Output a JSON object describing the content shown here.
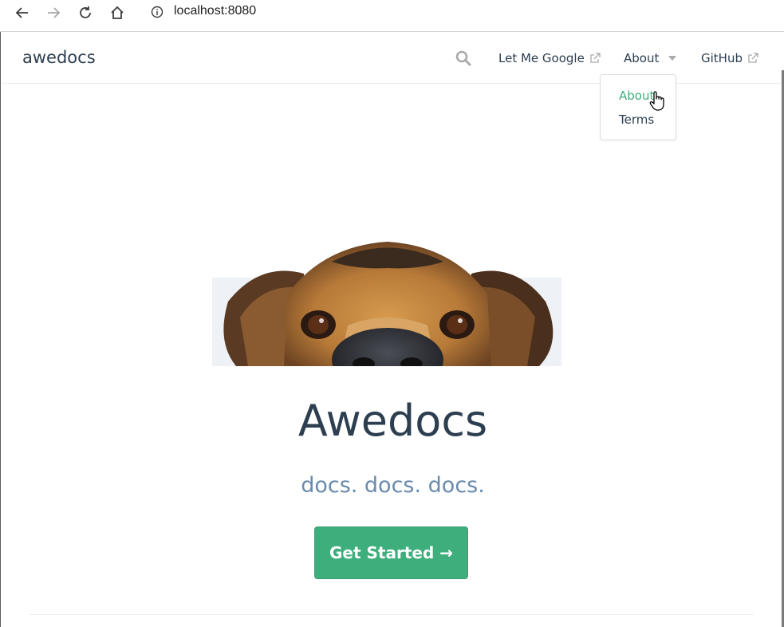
{
  "browser": {
    "url": "localhost:8080",
    "back_icon": "arrow-left-icon",
    "forward_icon": "arrow-right-icon",
    "reload_icon": "reload-icon",
    "home_icon": "home-icon",
    "info_icon": "info-circle-icon"
  },
  "navbar": {
    "site_name": "awedocs",
    "links": {
      "google": "Let Me Google",
      "about": "About",
      "github": "GitHub"
    }
  },
  "dropdown": {
    "items": [
      "About",
      "Terms"
    ],
    "active_index": 0
  },
  "hero": {
    "title": "Awedocs",
    "description": "docs. docs. docs.",
    "action_text": "Get Started →"
  },
  "colors": {
    "accent": "#3eaf7c",
    "text": "#2c3e50",
    "description": "#6a8bad"
  }
}
